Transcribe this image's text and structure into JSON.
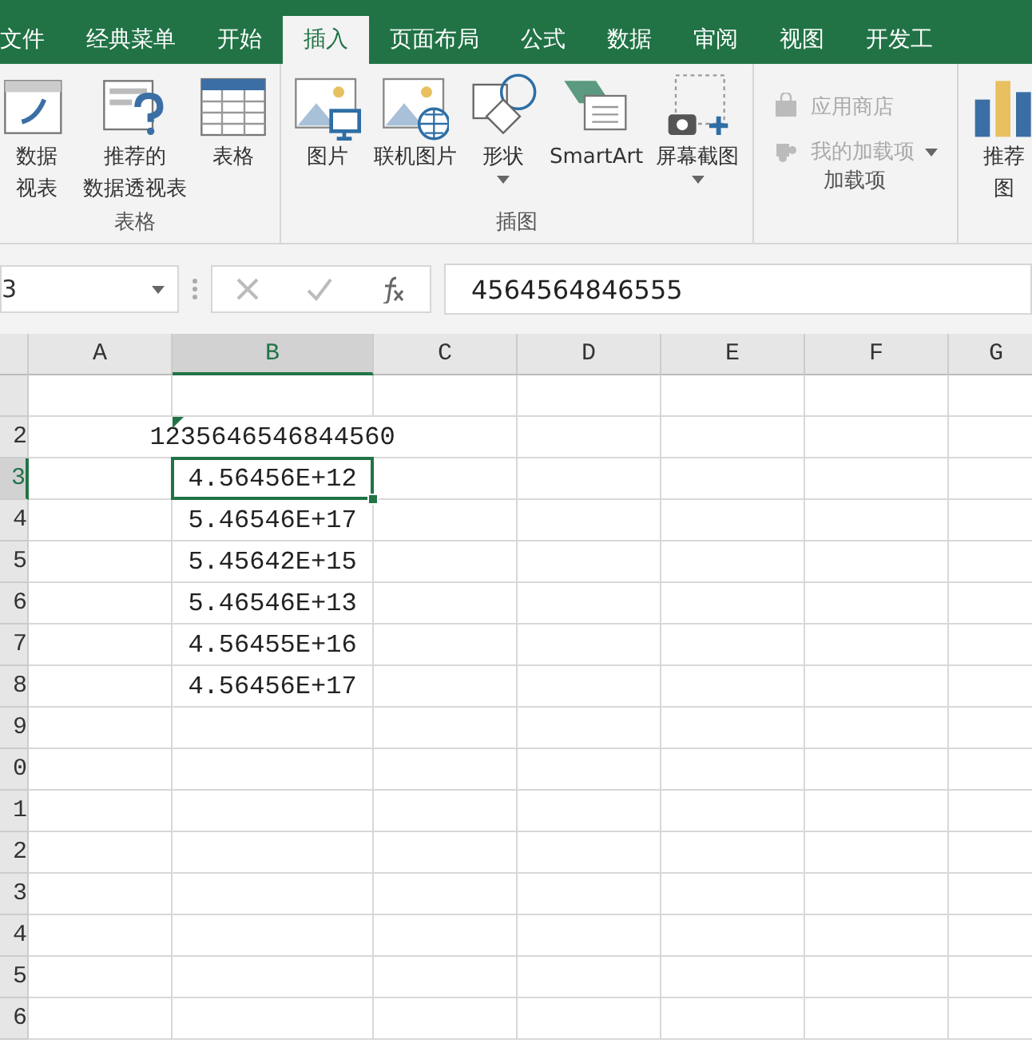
{
  "tabs": [
    {
      "label": "文件",
      "selected": false
    },
    {
      "label": "经典菜单",
      "selected": false
    },
    {
      "label": "开始",
      "selected": false
    },
    {
      "label": "插入",
      "selected": true
    },
    {
      "label": "页面布局",
      "selected": false
    },
    {
      "label": "公式",
      "selected": false
    },
    {
      "label": "数据",
      "selected": false
    },
    {
      "label": "审阅",
      "selected": false
    },
    {
      "label": "视图",
      "selected": false
    },
    {
      "label": "开发工",
      "selected": false
    }
  ],
  "ribbon_groups": [
    {
      "label": "表格",
      "items": [
        {
          "kind": "large",
          "lines": [
            "数据",
            "视表"
          ]
        },
        {
          "kind": "large",
          "lines": [
            "推荐的",
            "数据透视表"
          ]
        },
        {
          "kind": "large",
          "lines": [
            "表格"
          ]
        }
      ]
    },
    {
      "label": "插图",
      "items": [
        {
          "kind": "large",
          "lines": [
            "图片"
          ]
        },
        {
          "kind": "large",
          "lines": [
            "联机图片"
          ]
        },
        {
          "kind": "large",
          "lines": [
            "形状"
          ],
          "dropdown": true
        },
        {
          "kind": "large",
          "lines": [
            "SmartArt"
          ]
        },
        {
          "kind": "large",
          "lines": [
            "屏幕截图"
          ],
          "dropdown": true
        }
      ]
    },
    {
      "label": "加载项",
      "items": [
        {
          "kind": "small",
          "lines": [
            "应用商店"
          ],
          "disabled": true
        },
        {
          "kind": "small",
          "lines": [
            "我的加载项"
          ],
          "disabled": true,
          "dropdown": true
        }
      ]
    },
    {
      "items": [
        {
          "kind": "large",
          "lines": [
            "推荐",
            "图"
          ]
        }
      ]
    }
  ],
  "formula_bar": {
    "name_box": "3",
    "formula": "4564564846555"
  },
  "sheet": {
    "columns": [
      {
        "label": "A",
        "selected": false
      },
      {
        "label": "B",
        "selected": true
      },
      {
        "label": "C",
        "selected": false
      },
      {
        "label": "D",
        "selected": false
      },
      {
        "label": "E",
        "selected": false
      },
      {
        "label": "F",
        "selected": false
      },
      {
        "label": "G",
        "selected": false
      }
    ],
    "rows": [
      {
        "selected": false
      },
      {
        "header": "2",
        "selected": false,
        "value": "1235646546844560",
        "flag": true,
        "active": false
      },
      {
        "header": "3",
        "selected": true,
        "value": "4.56456E+12",
        "active": true
      },
      {
        "header": "4",
        "selected": false,
        "value": "5.46546E+17",
        "active": false
      },
      {
        "header": "5",
        "selected": false,
        "value": "5.45642E+15",
        "active": false
      },
      {
        "header": "6",
        "selected": false,
        "value": "5.46546E+13",
        "active": false
      },
      {
        "header": "7",
        "selected": false,
        "value": "4.56455E+16",
        "active": false
      },
      {
        "header": "8",
        "selected": false,
        "value": "4.56456E+17",
        "active": false
      },
      {
        "header": "9",
        "selected": false
      },
      {
        "header": "0",
        "selected": false
      },
      {
        "header": "1",
        "selected": false
      },
      {
        "header": "2",
        "selected": false
      },
      {
        "header": "3",
        "selected": false
      },
      {
        "header": "4",
        "selected": false
      },
      {
        "header": "5",
        "selected": false
      },
      {
        "header": "6",
        "selected": false
      }
    ]
  }
}
